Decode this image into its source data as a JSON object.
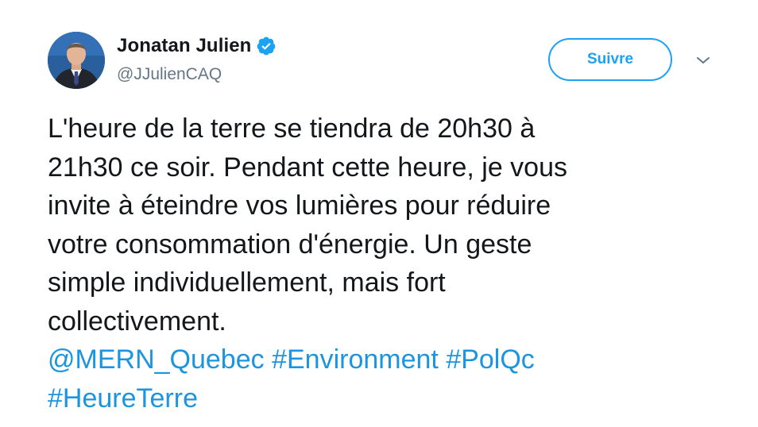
{
  "author": {
    "display_name": "Jonatan Julien",
    "handle": "@JJulienCAQ",
    "verified": true,
    "avatar_icon": "profile-photo"
  },
  "follow_button": {
    "label": "Suivre"
  },
  "menu": {
    "icon": "chevron-down-icon"
  },
  "tweet": {
    "lines": [
      "L'heure de la terre se tiendra de 20h30 à",
      "21h30 ce soir. Pendant cette heure, je vous",
      "invite à éteindre vos lumières pour réduire",
      "votre consommation d'énergie. Un geste",
      "simple individuellement, mais fort",
      "collectivement."
    ],
    "mention": "@MERN_Quebec",
    "hashtags": [
      "#Environment",
      "#PolQc",
      "#HeureTerre"
    ]
  },
  "colors": {
    "accent": "#1da1f2",
    "link": "#1b95e0",
    "text": "#14171a",
    "secondary": "#657786"
  }
}
